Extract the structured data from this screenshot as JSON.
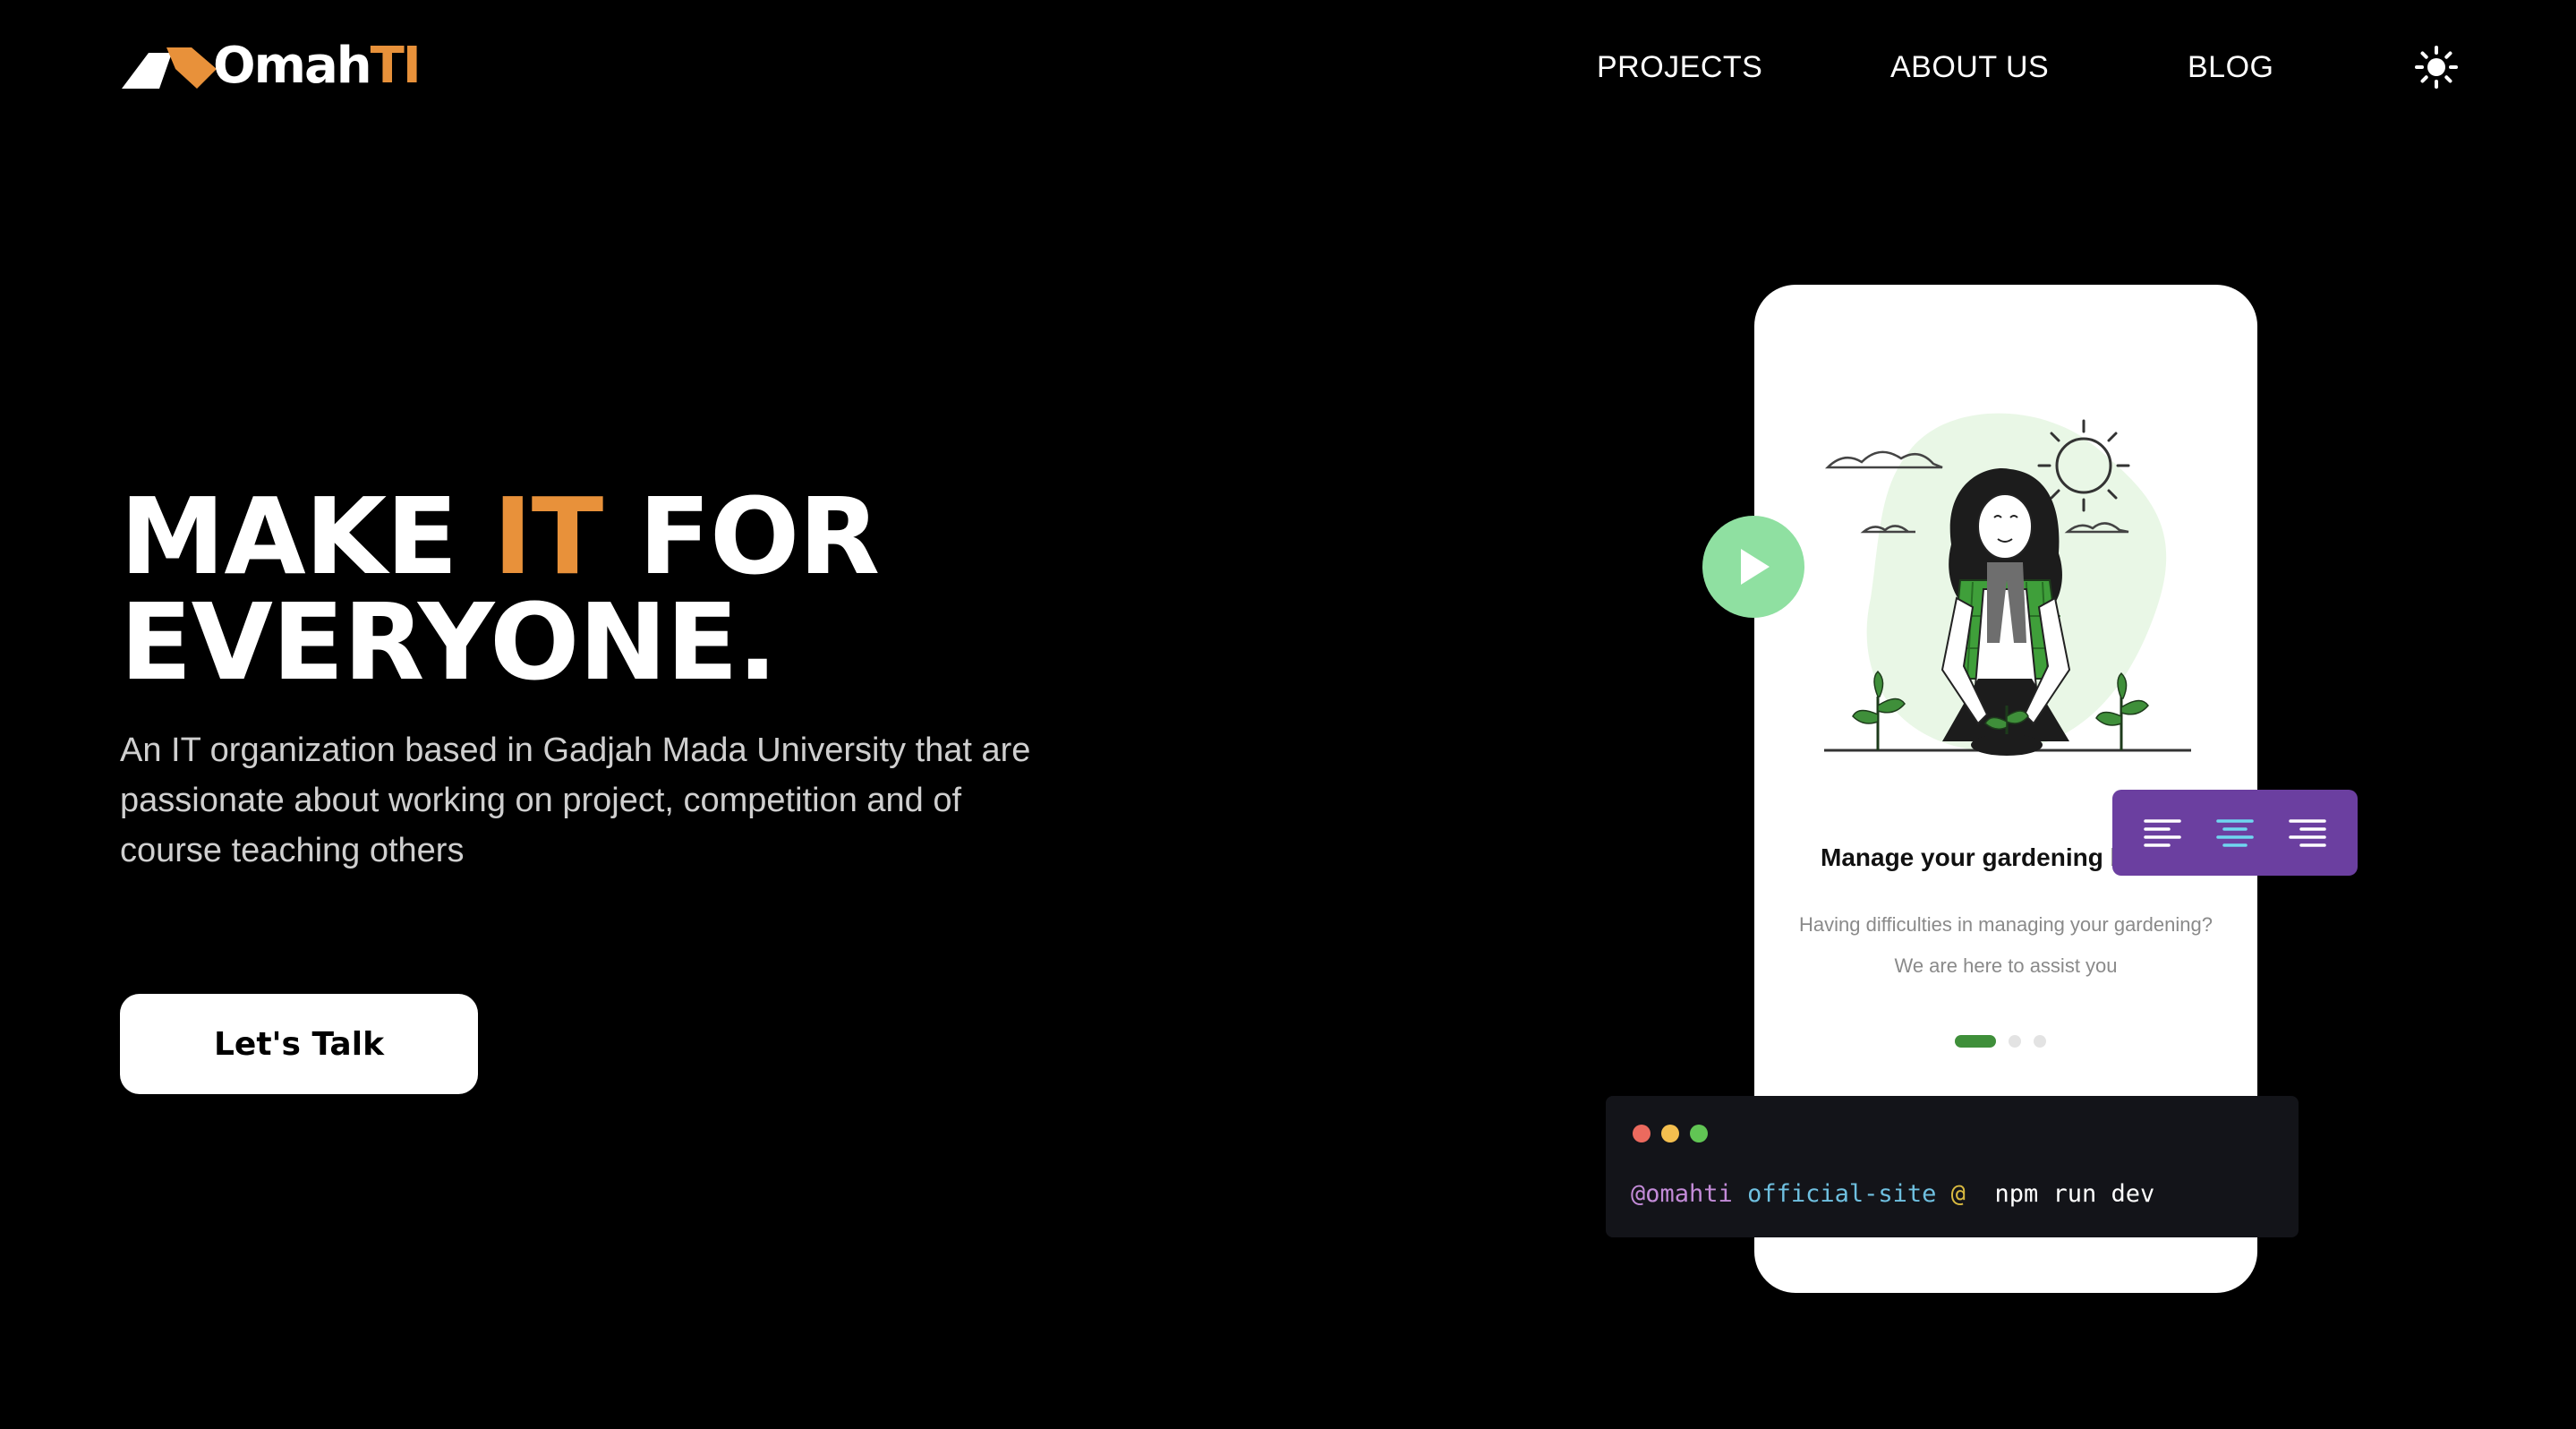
{
  "header": {
    "logo": {
      "text_part1": "Omah",
      "text_part2": "TI"
    },
    "nav": [
      {
        "label": "PROJECTS"
      },
      {
        "label": "ABOUT US"
      },
      {
        "label": "BLOG"
      }
    ],
    "theme_toggle_icon": "sun-icon"
  },
  "hero": {
    "headline": {
      "part1": "MAKE ",
      "accent": "IT",
      "part2": " FOR",
      "line2": "EVERYONE."
    },
    "subtitle": "An IT organization based in Gadjah Mada University that are passionate about working on project, competition and of course teaching others",
    "cta_label": "Let's Talk"
  },
  "showcase": {
    "card_title": "Manage your gardening b",
    "card_body_line1": "Having difficulties in managing your gardening?",
    "card_body_line2": "We are here to assist you",
    "pager": {
      "total": 3,
      "active": 1
    },
    "play_icon": "play-icon",
    "align_toolbar": [
      "align-left-icon",
      "align-center-icon",
      "align-right-icon"
    ],
    "terminal": {
      "user": "@omahti",
      "directory": "official-site",
      "separator": "@",
      "command": "npm run dev"
    }
  },
  "colors": {
    "background": "#000000",
    "accent": "#e8913a",
    "play_button": "#8fe0a1",
    "toolbar": "#6b3fa0",
    "pager_active": "#3f8f3a",
    "terminal_bg": "#131419"
  }
}
